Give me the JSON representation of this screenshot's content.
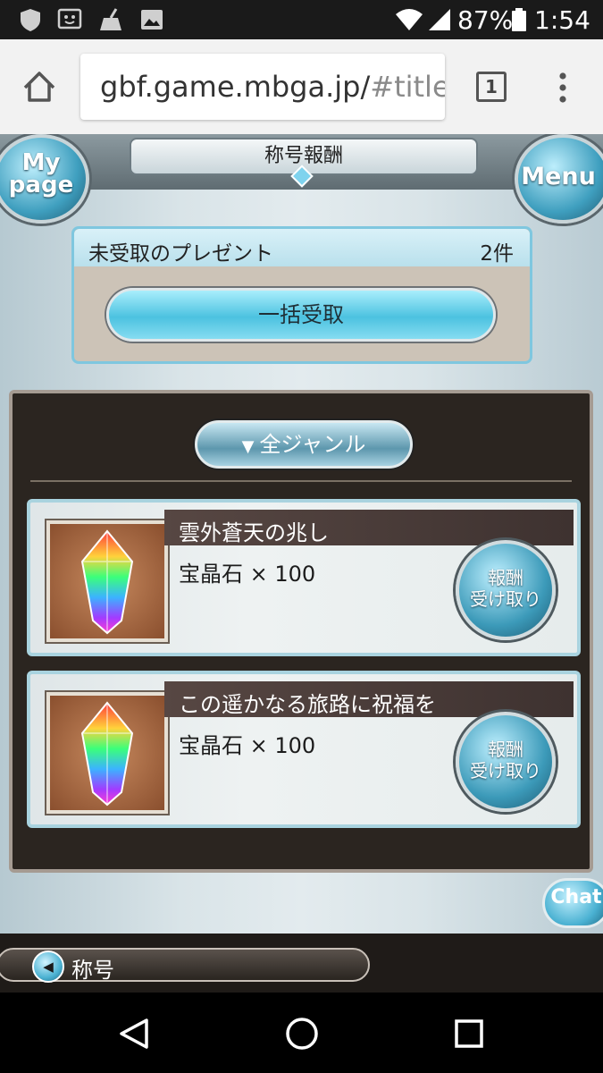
{
  "status_bar": {
    "icons": [
      "shield-icon",
      "face-notification-icon",
      "broom-icon",
      "image-icon",
      "wifi-icon",
      "signal-icon",
      "battery-icon"
    ],
    "battery": "87%",
    "time": "1:54"
  },
  "browser": {
    "url_host": "gbf.game.mbga.jp/",
    "url_hash": "#title",
    "tab_count": "1"
  },
  "game": {
    "title": "称号報酬",
    "mypage_line1": "My",
    "mypage_line2": "page",
    "menu": "Menu",
    "present": {
      "label": "未受取のプレゼント",
      "count": "2件",
      "bulk_button": "一括受取"
    },
    "genre_button": "全ジャンル",
    "rewards": [
      {
        "title": "雲外蒼天の兆し",
        "desc": "宝晶石 × 100",
        "button_line1": "報酬",
        "button_line2": "受け取り"
      },
      {
        "title": "この遥かなる旅路に祝福を",
        "desc": "宝晶石 × 100",
        "button_line1": "報酬",
        "button_line2": "受け取り"
      }
    ],
    "chat": "Chat",
    "back_label": "称号"
  },
  "colors": {
    "accent_blue": "#4cc2e0",
    "panel_dark": "#2b2520",
    "status_bar": "#1a1a1a"
  }
}
